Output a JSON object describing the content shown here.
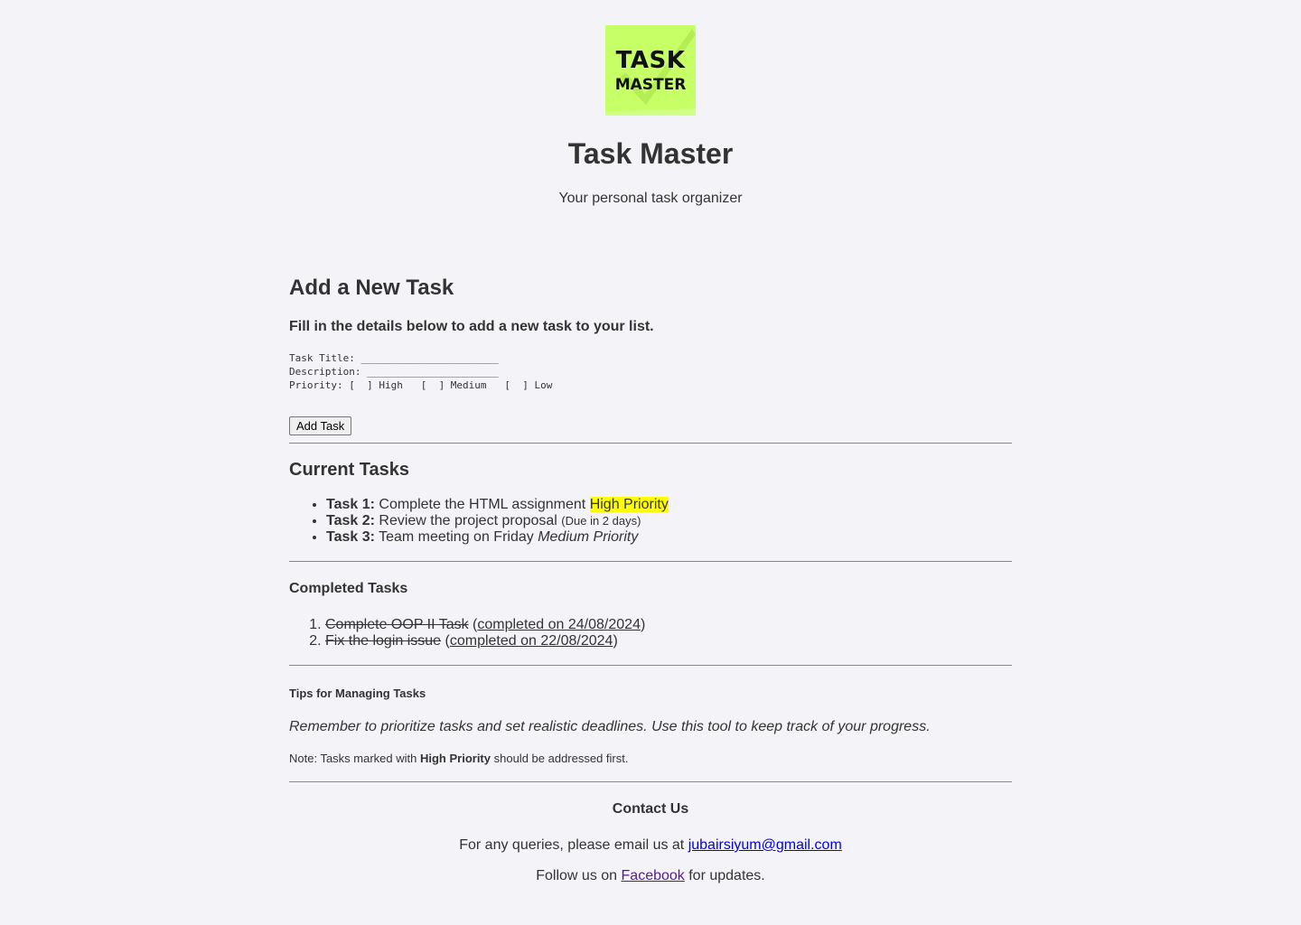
{
  "header": {
    "logo": {
      "line1": "TASK",
      "line2": "MASTER",
      "background": "#c6ff66"
    },
    "title": "Task Master",
    "tagline": "Your personal task organizer"
  },
  "add_task": {
    "heading": "Add a New Task",
    "intro": "Fill in the details below to add a new task to your list.",
    "form_text": "Task Title: _______________________\nDescription: ______________________\nPriority: [  ] High   [  ] Medium   [  ] Low",
    "button_label": "Add Task"
  },
  "current_tasks": {
    "heading": "Current Tasks",
    "items": [
      {
        "label": "Task 1:",
        "text": " Complete the HTML assignment ",
        "extra": "High Priority"
      },
      {
        "label": "Task 2:",
        "text": " Review the project proposal ",
        "extra": "(Due in 2 days)"
      },
      {
        "label": "Task 3:",
        "text": " Team meeting on Friday ",
        "extra": "Medium Priority"
      }
    ]
  },
  "completed_tasks": {
    "heading": "Completed Tasks",
    "items": [
      {
        "number": "1.",
        "task": "Complete OOP II Task",
        "open": " (",
        "completed": "completed on 24/08/2024",
        "close": ")"
      },
      {
        "number": "2.",
        "task": "Fix the login issue",
        "open": " (",
        "completed": "completed on 22/08/2024",
        "close": ")"
      }
    ]
  },
  "tips": {
    "heading": "Tips for Managing Tasks",
    "tip": "Remember to prioritize tasks and set realistic deadlines. Use this tool to keep track of your progress.",
    "note_prefix": "Note: Tasks marked with ",
    "note_bold": "High Priority",
    "note_suffix": " should be addressed first."
  },
  "contact": {
    "heading": "Contact Us",
    "email_prefix": "For any queries, please email us at ",
    "email": "jubairsiyum@gmail.com",
    "follow_prefix": "Follow us on ",
    "facebook": "Facebook",
    "follow_suffix": " for updates."
  },
  "colors": {
    "highlight": "#ffff00",
    "link": "#0000ee",
    "visited_link": "#551a8b",
    "page_background": "#f4f4f8"
  }
}
